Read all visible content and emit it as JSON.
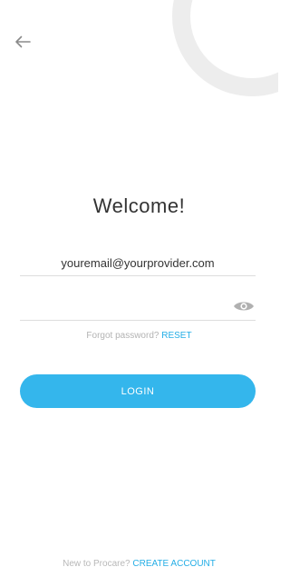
{
  "colors": {
    "accent": "#34b6ec",
    "link": "#25aee6",
    "muted_text": "#b3b3b3",
    "title_text": "#333333",
    "decor_ring": "#ededed"
  },
  "header": {
    "back_icon": "arrow-left-icon"
  },
  "login": {
    "title": "Welcome!",
    "email_value": "youremail@yourprovider.com",
    "password_value": "",
    "password_toggle_icon": "eye-icon",
    "forgot_text": "Forgot password?",
    "reset_label": "RESET",
    "login_label": "LOGIN"
  },
  "footer": {
    "new_text": "New to Procare?",
    "create_account_label": "CREATE ACCOUNT"
  }
}
